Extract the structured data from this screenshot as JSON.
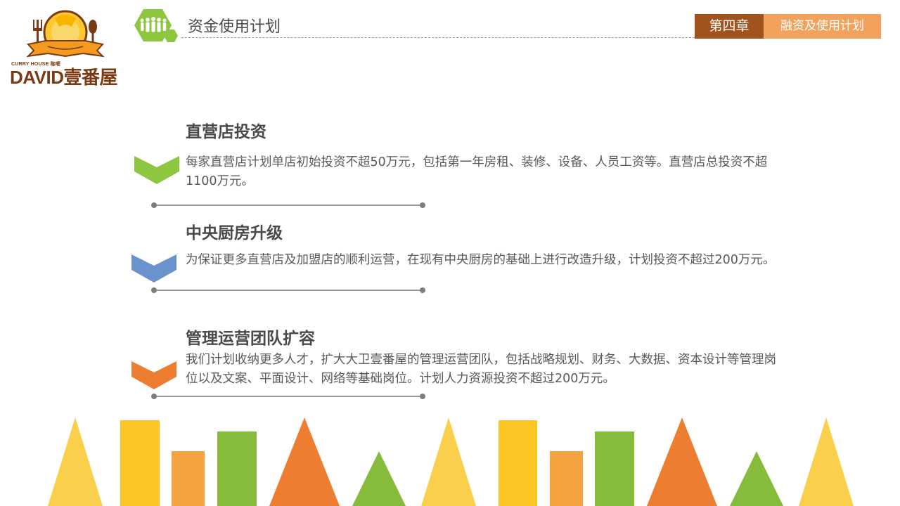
{
  "logo": {
    "tagline": "CURRY HOUSE 咖喱",
    "brand_latin": "DAVID",
    "brand_cn": "壹番屋"
  },
  "header": {
    "title": "资金使用计划",
    "chapter_tag": "第四章",
    "section_tag": "融资及使用计划"
  },
  "items": [
    {
      "title": "直营店投资",
      "desc": "每家直营店计划单店初始投资不超50万元，包括第一年房租、装修、设备、人员工资等。直营店总投资不超1100万元。",
      "color": "#8dc63f"
    },
    {
      "title": "中央厨房升级",
      "desc": "为保证更多直营店及加盟店的顺利运营，在现有中央厨房的基础上进行改造升级，计划投资不超过200万元。",
      "color": "#6a93cd"
    },
    {
      "title": "管理运营团队扩容",
      "desc": "我们计划收纳更多人才，扩大大卫壹番屋的管理运营团队，包括战略规划、财务、大数据、资本设计等管理岗位以及文案、平面设计、网络等基础岗位。计划人力资源投资不超过200万元。",
      "color": "#ed7d31"
    }
  ],
  "icons": {
    "header": "people-group-icon",
    "item_marker": "chevron-down-icon"
  },
  "colors": {
    "chapter_bg": "#a0531d",
    "section_bg": "#f2a25c",
    "yellow": "#fbc624",
    "light_yellow": "#f9cf4b",
    "orange": "#ed7d31",
    "light_orange": "#f4a13f",
    "green": "#86bb3c"
  }
}
